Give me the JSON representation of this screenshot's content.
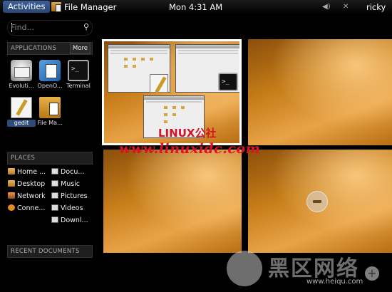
{
  "top_bar": {
    "activities_label": "Activities",
    "app_menu_label": "File Manager",
    "clock": "Mon  4:31 AM",
    "volume_icon": "speaker-icon",
    "network_icon": "network-icon",
    "user_name": "ricky"
  },
  "search": {
    "placeholder": "Find...",
    "icon": "search-icon"
  },
  "applications": {
    "header": "APPLICATIONS",
    "more_label": "More",
    "items": [
      {
        "label": "Evoluti...",
        "icon": "evolution-mail-icon"
      },
      {
        "label": "OpenO...",
        "icon": "openoffice-writer-icon"
      },
      {
        "label": "Terminal",
        "icon": "terminal-icon"
      },
      {
        "label": "gedit",
        "icon": "gedit-icon"
      },
      {
        "label": "File Ma...",
        "icon": "file-manager-icon"
      }
    ]
  },
  "places": {
    "header": "PLACES",
    "items": [
      {
        "label": "Home ...",
        "icon": "home-folder-icon"
      },
      {
        "label": "Docu...",
        "icon": "documents-icon"
      },
      {
        "label": "Desktop",
        "icon": "desktop-icon"
      },
      {
        "label": "Music",
        "icon": "music-icon"
      },
      {
        "label": "Network",
        "icon": "network-places-icon"
      },
      {
        "label": "Pictures",
        "icon": "pictures-icon"
      },
      {
        "label": "Conne...",
        "icon": "connect-server-icon"
      },
      {
        "label": "Videos",
        "icon": "videos-icon"
      },
      {
        "label": "Downl...",
        "icon": "downloads-icon"
      }
    ]
  },
  "recent_documents": {
    "header": "RECENT DOCUMENTS"
  },
  "workspaces": {
    "remove_icon": "remove-workspace-icon",
    "add_icon": "add-workspace-icon"
  },
  "watermarks": {
    "linux_logo": "LINUX公社",
    "url": "www.linuxidc.com",
    "corner_big": "黑区网络",
    "corner_small": "www.heiqu.com"
  }
}
